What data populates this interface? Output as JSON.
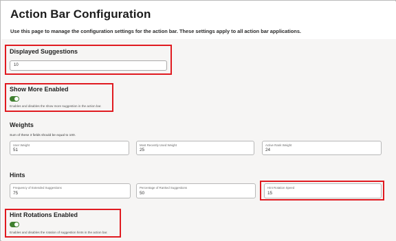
{
  "header": {
    "title": "Action Bar Configuration",
    "description": "Use this page to manage the configuration settings for the action bar. These settings apply to all action bar applications."
  },
  "displayed_suggestions": {
    "title": "Displayed Suggestions",
    "value": "10"
  },
  "show_more": {
    "title": "Show More Enabled",
    "helper": "Enables and disables the show more suggestion in the action bar.",
    "enabled": true
  },
  "weights": {
    "title": "Weights",
    "helper": "Sum of these 3 fields should be equal to 100.",
    "fields": [
      {
        "label": "User Weight",
        "value": "51"
      },
      {
        "label": "Most Recently Used Weight",
        "value": "25"
      },
      {
        "label": "Active Rank Weight",
        "value": "24"
      }
    ]
  },
  "hints": {
    "title": "Hints",
    "fields": [
      {
        "label": "Frequency of Extended Suggestions",
        "value": "75"
      },
      {
        "label": "Percentage of Ranked Suggestions",
        "value": "50"
      },
      {
        "label": "Hint Rotation Speed",
        "value": "15"
      }
    ]
  },
  "hint_rotations": {
    "title": "Hint Rotations Enabled",
    "helper": "Enables and disables the rotation of suggestion hints in the action bar.",
    "enabled": true
  },
  "colors": {
    "highlight": "#e0191f",
    "toggle_on": "#3f7f2f",
    "content_bg": "#f6f5f4"
  }
}
